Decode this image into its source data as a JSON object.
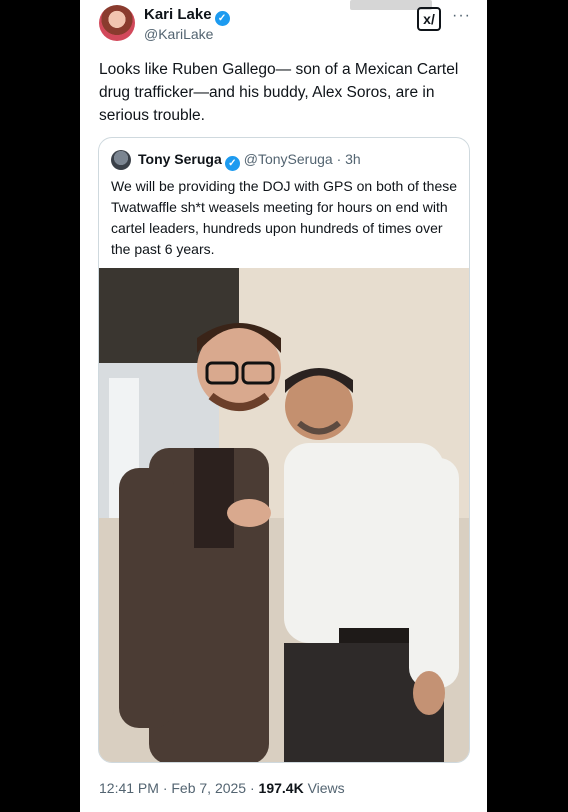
{
  "tweet": {
    "author_name": "Kari Lake",
    "author_handle": "@KariLake",
    "text": "Looks like Ruben Gallego— son of a Mexican Cartel drug trafficker—and his buddy, Alex Soros, are in serious trouble.",
    "timestamp": "12:41 PM · Feb 7, 2025 ·",
    "views_count": "197.4K",
    "views_label": "Views",
    "grok_label": "x/",
    "more_label": "···",
    "verified_mark": "✓"
  },
  "quote": {
    "author_name": "Tony Seruga",
    "author_handle": "@TonySeruga · 3h",
    "verified_mark": "✓",
    "text": "We will be providing the DOJ with GPS on both of these Twatwaffle sh*t weasels meeting for hours on end with cartel leaders, hundreds upon hundreds of times over the past 6 years."
  },
  "colors": {
    "verified": "#1d9bf0",
    "text_primary": "#0f1419",
    "text_secondary": "#536471",
    "border": "#cfd9de"
  },
  "icons": [
    "verified-icon",
    "grok-icon",
    "more-icon"
  ]
}
